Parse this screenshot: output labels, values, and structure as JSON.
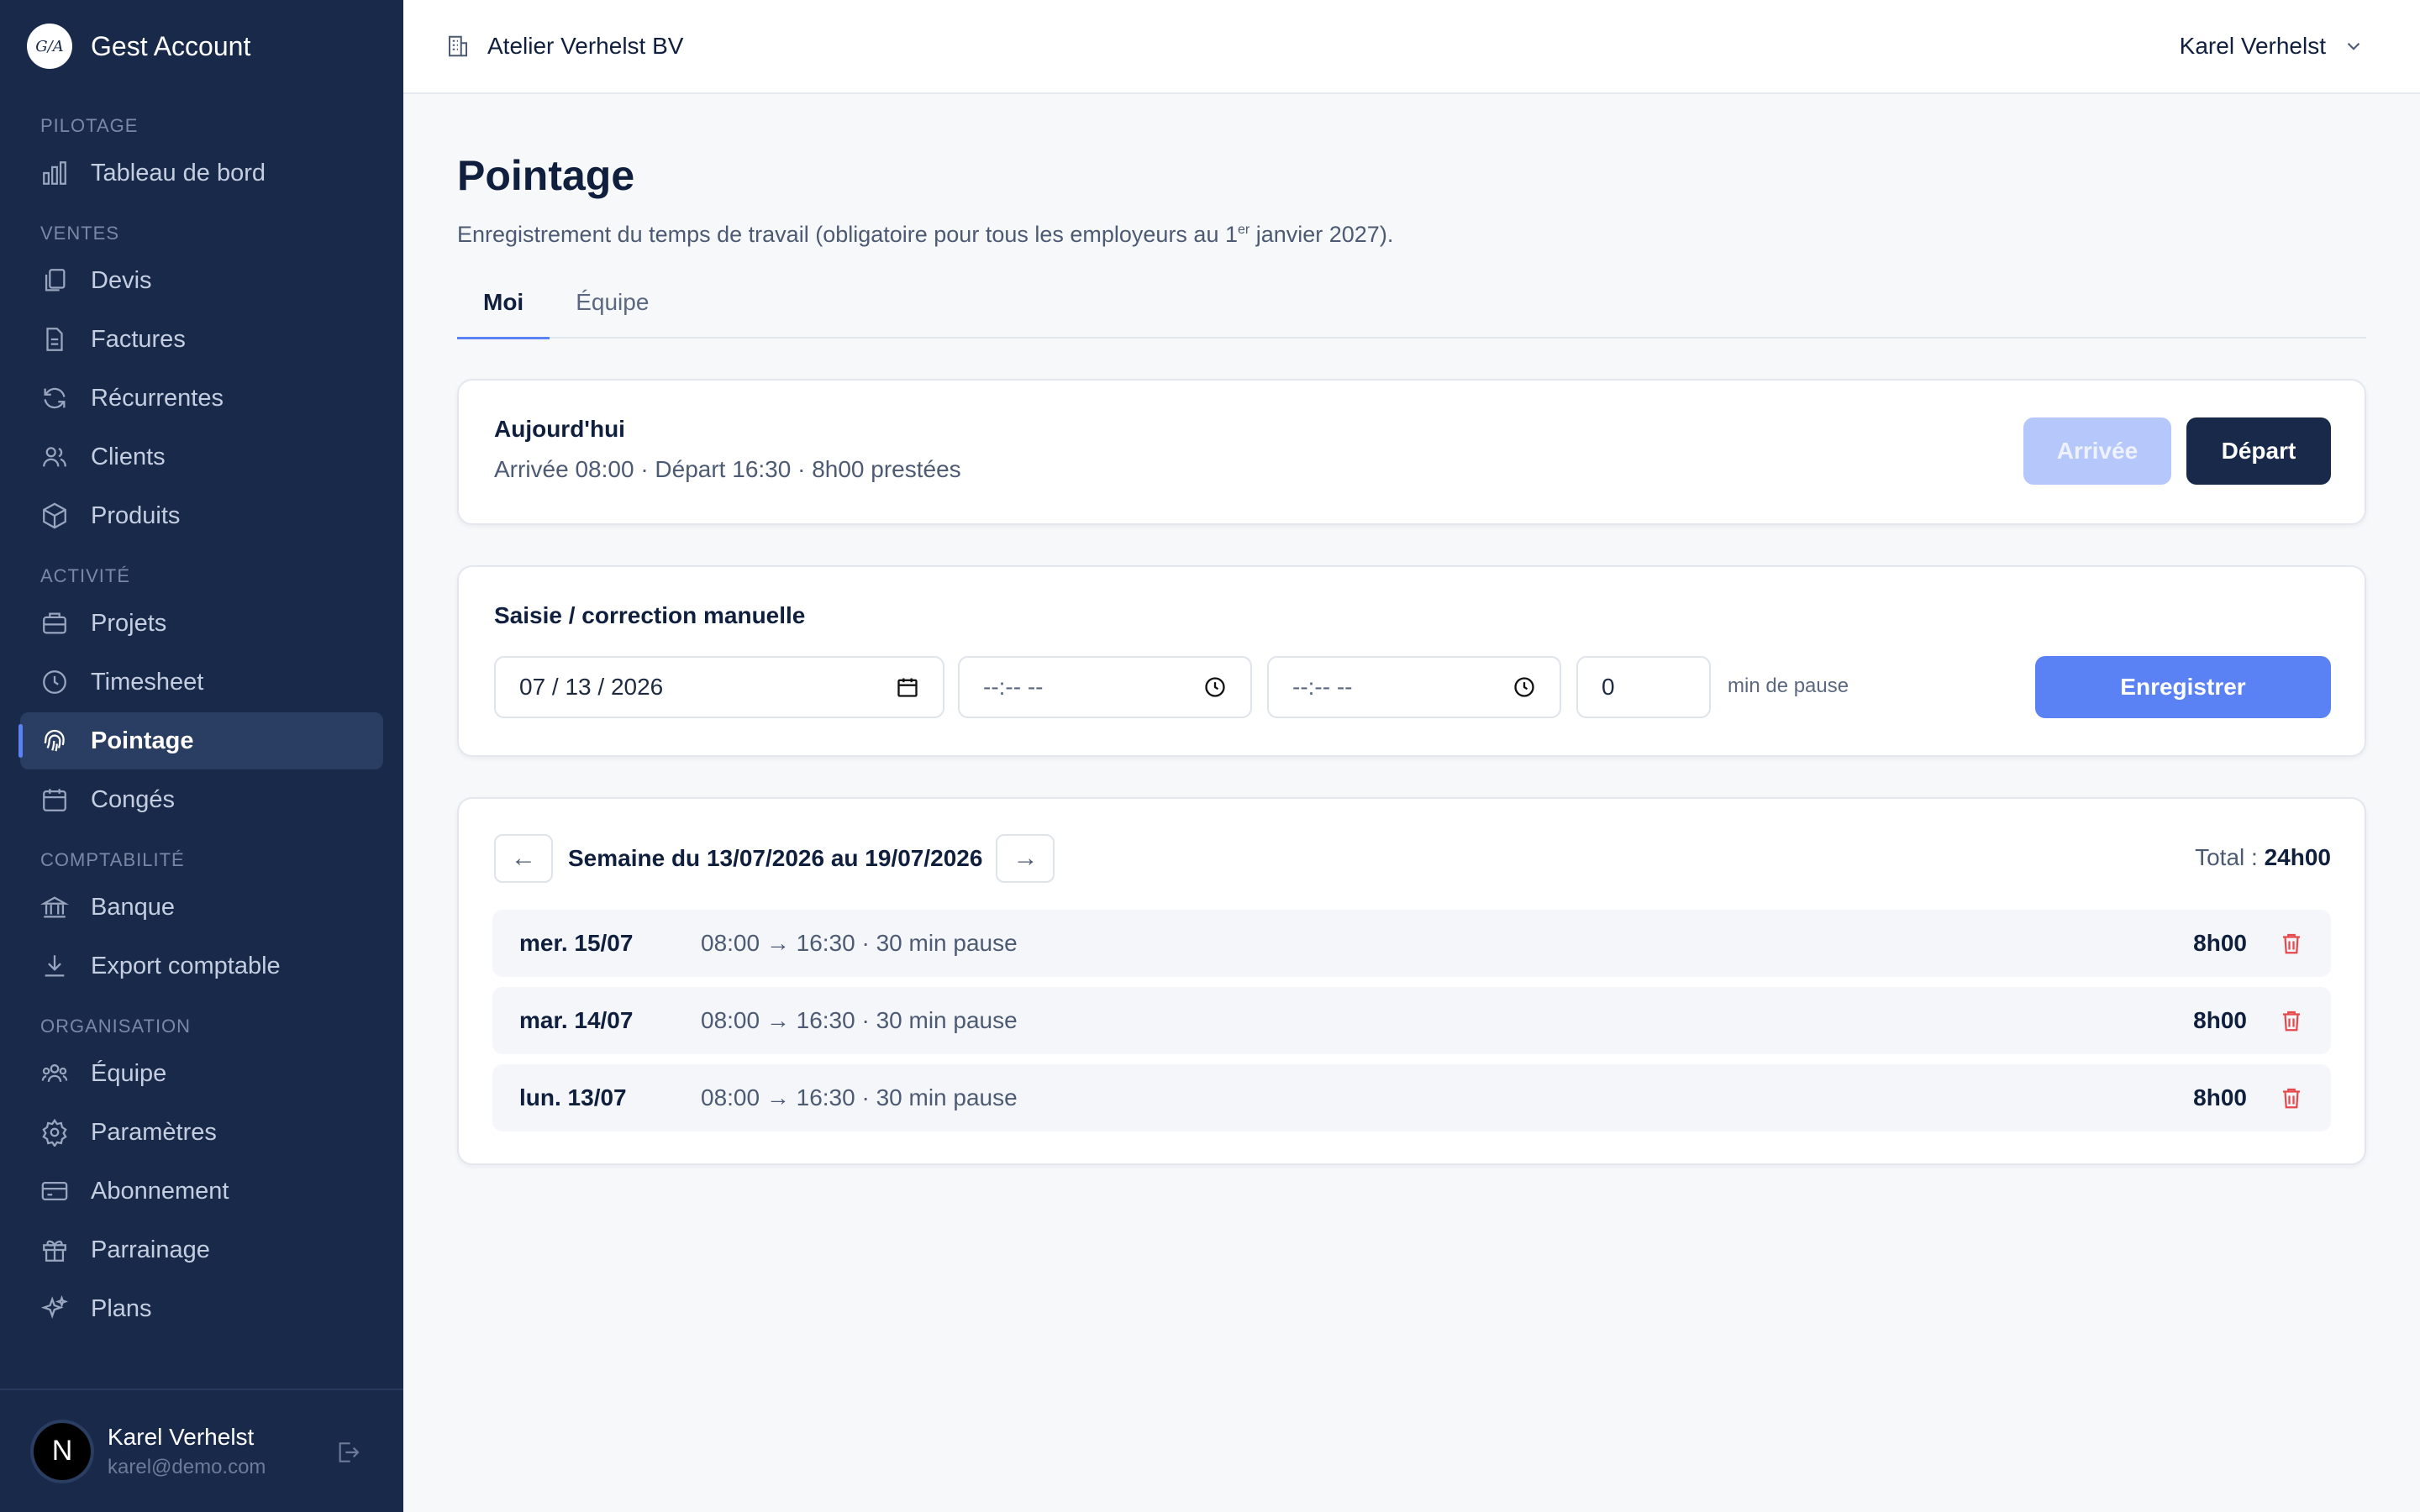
{
  "brand": {
    "logo_text": "G/A",
    "name": "Gest Account"
  },
  "sidebar": {
    "sections": [
      {
        "title": "PILOTAGE",
        "items": [
          {
            "label": "Tableau de bord",
            "icon": "chart-bars-icon"
          }
        ]
      },
      {
        "title": "VENTES",
        "items": [
          {
            "label": "Devis",
            "icon": "copy-doc-icon"
          },
          {
            "label": "Factures",
            "icon": "file-icon"
          },
          {
            "label": "Récurrentes",
            "icon": "refresh-icon"
          },
          {
            "label": "Clients",
            "icon": "users-icon"
          },
          {
            "label": "Produits",
            "icon": "box-icon"
          }
        ]
      },
      {
        "title": "ACTIVITÉ",
        "items": [
          {
            "label": "Projets",
            "icon": "briefcase-icon"
          },
          {
            "label": "Timesheet",
            "icon": "clock-icon"
          },
          {
            "label": "Pointage",
            "icon": "fingerprint-icon",
            "active": true
          },
          {
            "label": "Congés",
            "icon": "calendar-icon"
          }
        ]
      },
      {
        "title": "COMPTABILITÉ",
        "items": [
          {
            "label": "Banque",
            "icon": "bank-icon"
          },
          {
            "label": "Export comptable",
            "icon": "download-icon"
          }
        ]
      },
      {
        "title": "ORGANISATION",
        "items": [
          {
            "label": "Équipe",
            "icon": "team-icon"
          },
          {
            "label": "Paramètres",
            "icon": "gear-icon"
          },
          {
            "label": "Abonnement",
            "icon": "credit-card-icon"
          },
          {
            "label": "Parrainage",
            "icon": "gift-icon"
          },
          {
            "label": "Plans",
            "icon": "sparkles-icon"
          }
        ]
      }
    ]
  },
  "user": {
    "avatar_letter": "N",
    "name": "Karel Verhelst",
    "email": "karel@demo.com"
  },
  "topbar": {
    "organization": "Atelier Verhelst BV",
    "account_name": "Karel Verhelst"
  },
  "page": {
    "title": "Pointage",
    "subtitle_before": "Enregistrement du temps de travail (obligatoire pour tous les employeurs au 1",
    "subtitle_sup": "er",
    "subtitle_after": " janvier 2027).",
    "tabs": [
      {
        "label": "Moi",
        "active": true
      },
      {
        "label": "Équipe",
        "active": false
      }
    ]
  },
  "today": {
    "title": "Aujourd'hui",
    "summary": "Arrivée 08:00 · Départ 16:30 · 8h00 prestées",
    "arrive_label": "Arrivée",
    "depart_label": "Départ"
  },
  "manual": {
    "title": "Saisie / correction manuelle",
    "date_value": "07 / 13 / 2026",
    "start_time": "--:-- --",
    "end_time": "--:-- --",
    "pause_value": "0",
    "pause_label": "min de pause",
    "save_label": "Enregistrer"
  },
  "week": {
    "prev_label": "←",
    "next_label": "→",
    "label": "Semaine du 13/07/2026 au 19/07/2026",
    "total_label": "Total : ",
    "total_value": "24h00",
    "entries": [
      {
        "day": "mer. 15/07",
        "detail": "08:00 → 16:30 · 30 min pause",
        "hours": "8h00"
      },
      {
        "day": "mar. 14/07",
        "detail": "08:00 → 16:30 · 30 min pause",
        "hours": "8h00"
      },
      {
        "day": "lun. 13/07",
        "detail": "08:00 → 16:30 · 30 min pause",
        "hours": "8h00"
      }
    ]
  },
  "colors": {
    "sidebar_bg": "#18294a",
    "accent": "#5b82f4",
    "danger": "#e5484d",
    "dark_button": "#18294a"
  }
}
